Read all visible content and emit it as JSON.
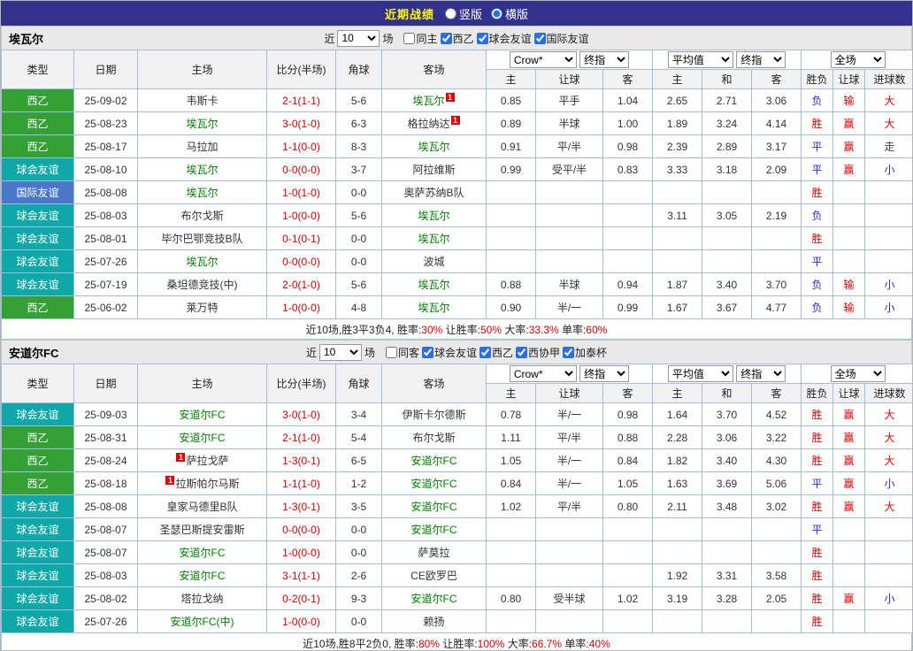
{
  "topbar": {
    "title": "近期战绩",
    "layout_options": [
      {
        "label": "竖版",
        "selected": false
      },
      {
        "label": "横版",
        "selected": true
      }
    ]
  },
  "filter": {
    "prefix": "近",
    "count": "10",
    "suffix": "场"
  },
  "selects": {
    "company": "Crow*",
    "final": "终指",
    "average": "平均值",
    "full": "全场"
  },
  "columns": {
    "type": "类型",
    "date": "日期",
    "home": "主场",
    "score": "比分(半场)",
    "corner": "角球",
    "away": "客场",
    "sub": [
      "主",
      "让球",
      "客",
      "主",
      "和",
      "客",
      "胜负",
      "让球",
      "进球数"
    ]
  },
  "badge_label": "1",
  "type_colors": {
    "西乙": "#35a035",
    "球会友谊": "#0fa8a8",
    "国际友谊": "#4a77c9"
  },
  "mark_colors": {
    "胜": "#e00000",
    "平": "#2a2ad0",
    "负": "#2a2ad0",
    "赢": "#e00000",
    "输": "#e00000",
    "走": "#444444",
    "大": "#e00000",
    "小": "#2a2ad0"
  },
  "sections": [
    {
      "team": "埃瓦尔",
      "filters": [
        {
          "label": "同主",
          "checked": false
        },
        {
          "label": "西乙",
          "checked": true
        },
        {
          "label": "球会友谊",
          "checked": true
        },
        {
          "label": "国际友谊",
          "checked": true
        }
      ],
      "rows": [
        {
          "type": "西乙",
          "date": "25-09-02",
          "home": {
            "text": "韦斯卡"
          },
          "score": "2-1(1-1)",
          "corner": "5-6",
          "away": {
            "text": "埃瓦尔",
            "focus": true,
            "badge": "after"
          },
          "odds": [
            "0.85",
            "平手",
            "1.04"
          ],
          "avg": [
            "2.65",
            "2.71",
            "3.06"
          ],
          "result": "负",
          "handicap": "输",
          "goals": "大"
        },
        {
          "type": "西乙",
          "date": "25-08-23",
          "home": {
            "text": "埃瓦尔",
            "focus": true
          },
          "score": "3-0(1-0)",
          "corner": "6-3",
          "away": {
            "text": "格拉纳达",
            "badge": "after"
          },
          "odds": [
            "0.89",
            "半球",
            "1.00"
          ],
          "avg": [
            "1.89",
            "3.24",
            "4.14"
          ],
          "result": "胜",
          "handicap": "赢",
          "goals": "大"
        },
        {
          "type": "西乙",
          "date": "25-08-17",
          "home": {
            "text": "马拉加"
          },
          "score": "1-1(0-0)",
          "corner": "8-3",
          "away": {
            "text": "埃瓦尔",
            "focus": true
          },
          "odds": [
            "0.91",
            "平/半",
            "0.98"
          ],
          "avg": [
            "2.39",
            "2.89",
            "3.17"
          ],
          "result": "平",
          "handicap": "赢",
          "goals": "走"
        },
        {
          "type": "球会友谊",
          "date": "25-08-10",
          "home": {
            "text": "埃瓦尔",
            "focus": true
          },
          "score": "0-0(0-0)",
          "corner": "3-7",
          "away": {
            "text": "阿拉维斯"
          },
          "odds": [
            "0.99",
            "受平/半",
            "0.83"
          ],
          "avg": [
            "3.33",
            "3.18",
            "2.09"
          ],
          "result": "平",
          "handicap": "赢",
          "goals": "小"
        },
        {
          "type": "国际友谊",
          "date": "25-08-08",
          "home": {
            "text": "埃瓦尔",
            "focus": true
          },
          "score": "1-0(1-0)",
          "corner": "0-0",
          "away": {
            "text": "奥萨苏纳B队"
          },
          "odds": null,
          "avg": null,
          "result": "胜",
          "handicap": "",
          "goals": ""
        },
        {
          "type": "球会友谊",
          "date": "25-08-03",
          "home": {
            "text": "布尔戈斯"
          },
          "score": "1-0(0-0)",
          "corner": "5-6",
          "away": {
            "text": "埃瓦尔",
            "focus": true
          },
          "odds": null,
          "avg": [
            "3.11",
            "3.05",
            "2.19"
          ],
          "result": "负",
          "handicap": "",
          "goals": ""
        },
        {
          "type": "球会友谊",
          "date": "25-08-01",
          "home": {
            "text": "毕尔巴鄂竞技B队"
          },
          "score": "0-1(0-1)",
          "corner": "0-0",
          "away": {
            "text": "埃瓦尔",
            "focus": true
          },
          "odds": null,
          "avg": null,
          "result": "胜",
          "handicap": "",
          "goals": ""
        },
        {
          "type": "球会友谊",
          "date": "25-07-26",
          "home": {
            "text": "埃瓦尔",
            "focus": true
          },
          "score": "0-0(0-0)",
          "corner": "0-0",
          "away": {
            "text": "波城"
          },
          "odds": null,
          "avg": null,
          "result": "平",
          "handicap": "",
          "goals": ""
        },
        {
          "type": "球会友谊",
          "date": "25-07-19",
          "home": {
            "text": "桑坦德竞技(中)"
          },
          "score": "2-0(1-0)",
          "corner": "5-6",
          "away": {
            "text": "埃瓦尔",
            "focus": true
          },
          "odds": [
            "0.88",
            "半球",
            "0.94"
          ],
          "avg": [
            "1.87",
            "3.40",
            "3.70"
          ],
          "result": "负",
          "handicap": "输",
          "goals": "小"
        },
        {
          "type": "西乙",
          "date": "25-06-02",
          "home": {
            "text": "莱万特"
          },
          "score": "1-0(0-0)",
          "corner": "4-8",
          "away": {
            "text": "埃瓦尔",
            "focus": true
          },
          "odds": [
            "0.90",
            "半/一",
            "0.99"
          ],
          "avg": [
            "1.67",
            "3.67",
            "4.77"
          ],
          "result": "负",
          "handicap": "输",
          "goals": "小"
        }
      ],
      "summary": [
        {
          "t": "近10场,胜3平3负4, "
        },
        {
          "t": "胜率:"
        },
        {
          "t": "30%",
          "red": true
        },
        {
          "t": " 让胜率:"
        },
        {
          "t": "50%",
          "red": true
        },
        {
          "t": " 大率:"
        },
        {
          "t": "33.3%",
          "red": true
        },
        {
          "t": " 单率:"
        },
        {
          "t": "60%",
          "red": true
        }
      ]
    },
    {
      "team": "安道尔FC",
      "filters": [
        {
          "label": "同客",
          "checked": false
        },
        {
          "label": "球会友谊",
          "checked": true
        },
        {
          "label": "西乙",
          "checked": true
        },
        {
          "label": "西协甲",
          "checked": true
        },
        {
          "label": "加泰杯",
          "checked": true
        }
      ],
      "rows": [
        {
          "type": "球会友谊",
          "date": "25-09-03",
          "home": {
            "text": "安道尔FC",
            "focus": true
          },
          "score": "3-0(1-0)",
          "corner": "3-4",
          "away": {
            "text": "伊斯卡尔德斯"
          },
          "odds": [
            "0.78",
            "半/一",
            "0.98"
          ],
          "avg": [
            "1.64",
            "3.70",
            "4.52"
          ],
          "result": "胜",
          "handicap": "赢",
          "goals": "大"
        },
        {
          "type": "西乙",
          "date": "25-08-31",
          "home": {
            "text": "安道尔FC",
            "focus": true
          },
          "score": "2-1(1-0)",
          "corner": "5-4",
          "away": {
            "text": "布尔戈斯"
          },
          "odds": [
            "1.11",
            "平/半",
            "0.88"
          ],
          "avg": [
            "2.28",
            "3.06",
            "3.22"
          ],
          "result": "胜",
          "handicap": "赢",
          "goals": "大"
        },
        {
          "type": "西乙",
          "date": "25-08-24",
          "home": {
            "text": "萨拉戈萨",
            "badge": "before"
          },
          "score": "1-3(0-1)",
          "corner": "6-5",
          "away": {
            "text": "安道尔FC",
            "focus": true
          },
          "odds": [
            "1.05",
            "半/一",
            "0.84"
          ],
          "avg": [
            "1.82",
            "3.40",
            "4.30"
          ],
          "result": "胜",
          "handicap": "赢",
          "goals": "大"
        },
        {
          "type": "西乙",
          "date": "25-08-18",
          "home": {
            "text": "拉斯帕尔马斯",
            "badge": "before"
          },
          "score": "1-1(1-0)",
          "corner": "1-2",
          "away": {
            "text": "安道尔FC",
            "focus": true
          },
          "odds": [
            "0.84",
            "半/一",
            "1.05"
          ],
          "avg": [
            "1.63",
            "3.69",
            "5.06"
          ],
          "result": "平",
          "handicap": "赢",
          "goals": "小"
        },
        {
          "type": "球会友谊",
          "date": "25-08-08",
          "home": {
            "text": "皇家马德里B队"
          },
          "score": "1-3(0-1)",
          "corner": "3-5",
          "away": {
            "text": "安道尔FC",
            "focus": true
          },
          "odds": [
            "1.02",
            "平/半",
            "0.80"
          ],
          "avg": [
            "2.11",
            "3.48",
            "3.02"
          ],
          "result": "胜",
          "handicap": "赢",
          "goals": "大"
        },
        {
          "type": "球会友谊",
          "date": "25-08-07",
          "home": {
            "text": "圣瑟巴斯提安雷斯"
          },
          "score": "0-0(0-0)",
          "corner": "0-0",
          "away": {
            "text": "安道尔FC",
            "focus": true
          },
          "odds": null,
          "avg": null,
          "result": "平",
          "handicap": "",
          "goals": ""
        },
        {
          "type": "球会友谊",
          "date": "25-08-07",
          "home": {
            "text": "安道尔FC",
            "focus": true
          },
          "score": "1-0(0-0)",
          "corner": "0-0",
          "away": {
            "text": "萨莫拉"
          },
          "odds": null,
          "avg": null,
          "result": "胜",
          "handicap": "",
          "goals": ""
        },
        {
          "type": "球会友谊",
          "date": "25-08-03",
          "home": {
            "text": "安道尔FC",
            "focus": true
          },
          "score": "3-1(1-1)",
          "corner": "2-6",
          "away": {
            "text": "CE欧罗巴"
          },
          "odds": null,
          "avg": [
            "1.92",
            "3.31",
            "3.58"
          ],
          "result": "胜",
          "handicap": "",
          "goals": ""
        },
        {
          "type": "球会友谊",
          "date": "25-08-02",
          "home": {
            "text": "塔拉戈纳"
          },
          "score": "0-2(0-1)",
          "corner": "9-3",
          "away": {
            "text": "安道尔FC",
            "focus": true
          },
          "odds": [
            "0.80",
            "受半球",
            "1.02"
          ],
          "avg": [
            "3.19",
            "3.28",
            "2.05"
          ],
          "result": "胜",
          "handicap": "赢",
          "goals": "小"
        },
        {
          "type": "球会友谊",
          "date": "25-07-26",
          "home": {
            "text": "安道尔FC(中)",
            "focus": true
          },
          "score": "1-0(0-0)",
          "corner": "0-0",
          "away": {
            "text": "赖扬"
          },
          "odds": null,
          "avg": null,
          "result": "胜",
          "handicap": "",
          "goals": ""
        }
      ],
      "summary": [
        {
          "t": "近10场,胜8平2负0, "
        },
        {
          "t": "胜率:"
        },
        {
          "t": "80%",
          "red": true
        },
        {
          "t": " 让胜率:"
        },
        {
          "t": "100%",
          "red": true
        },
        {
          "t": " 大率:"
        },
        {
          "t": "66.7%",
          "red": true
        },
        {
          "t": " 单率:"
        },
        {
          "t": "40%",
          "red": true
        }
      ]
    }
  ]
}
